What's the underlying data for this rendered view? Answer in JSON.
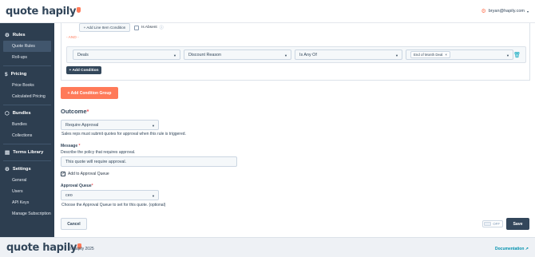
{
  "brand": {
    "logo_text": "quote hapily"
  },
  "header": {
    "user_email": "bryan@hapily.com",
    "user_icon": "gear-icon"
  },
  "sidebar": {
    "sections": [
      {
        "label": "Rules",
        "icon": "gear-icon",
        "items": [
          "Quote Rules",
          "Roll-ups"
        ]
      },
      {
        "label": "Pricing",
        "icon": "dollar-icon",
        "items": [
          "Price Books",
          "Calculated Pricing"
        ]
      },
      {
        "label": "Bundles",
        "icon": "box-icon",
        "items": [
          "Bundles",
          "Collections"
        ]
      },
      {
        "label": "Terms Library",
        "icon": "book-icon",
        "items": []
      },
      {
        "label": "Settings",
        "icon": "gear-icon",
        "items": [
          "General",
          "Users",
          "API Keys",
          "Manage Subscription"
        ]
      }
    ],
    "active_item": "Quote Rules"
  },
  "conditions": {
    "add_line_item_label": "+ Add Line Item Condition",
    "is_absent_label": "Is Absent",
    "and_label": "- AND -",
    "row": {
      "object": "Deals",
      "property": "Discount Reason",
      "operator": "Is Any Of",
      "value_tag": "End of Month Deal",
      "tag_remove": "×"
    },
    "add_condition_label": "+ Add Condition",
    "add_condition_group_label": "+ Add Condition Group"
  },
  "outcome": {
    "title": "Outcome",
    "required_mark": "*",
    "action_value": "Require Approval",
    "action_help": "Sales reps must submit quotes for approval when this rule is triggered.",
    "message_label": "Message",
    "message_help": "Describe the policy that requires approval.",
    "message_value": "This quote will require approval.",
    "add_to_queue_label": "Add to Approval Queue",
    "add_to_queue_checked": true,
    "queue_label": "Approval Queue",
    "queue_value": "ceo",
    "queue_help": "Choose the Approval Queue to set for this quote. (optional)"
  },
  "actions": {
    "cancel_label": "Cancel",
    "toggle_label": "OFF",
    "save_label": "Save"
  },
  "footer": {
    "logo_text": "quote hapily",
    "copyright": "© hapily 2025",
    "documentation_label": "Documentation"
  },
  "colors": {
    "accent": "#ff7a59",
    "sidebar_bg": "#2d3e50",
    "primary_dark": "#33475b",
    "link": "#0091ae"
  }
}
